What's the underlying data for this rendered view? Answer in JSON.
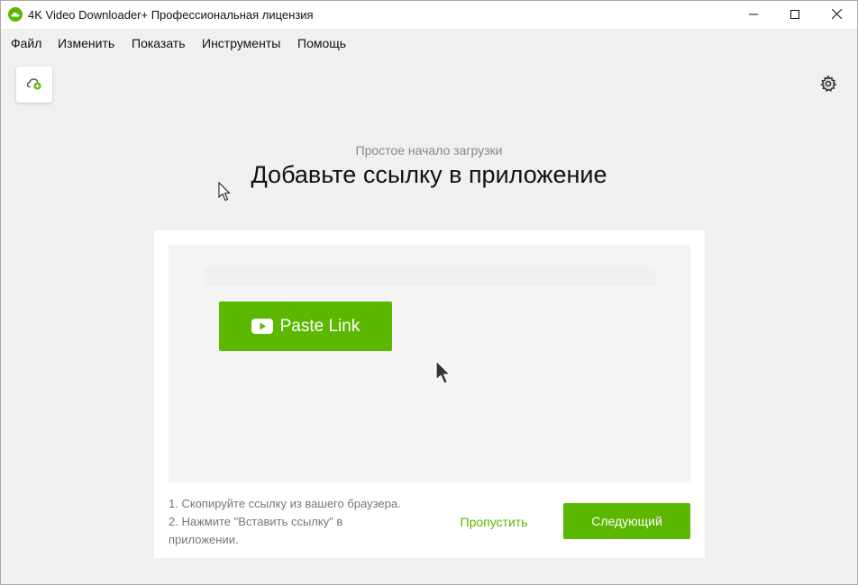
{
  "window": {
    "title": "4K Video Downloader+ Профессиональная лицензия",
    "app_icon": "cloud-download-icon",
    "controls": [
      "minimize-icon",
      "maximize-icon",
      "close-icon"
    ]
  },
  "menu": {
    "items": [
      {
        "label": "Файл"
      },
      {
        "label": "Изменить"
      },
      {
        "label": "Показать"
      },
      {
        "label": "Инструменты"
      },
      {
        "label": "Помощь"
      }
    ]
  },
  "toolbar": {
    "add_link_icon": "add-link-icon",
    "settings_icon": "gear-icon"
  },
  "onboarding": {
    "subtitle": "Простое начало загрузки",
    "headline": "Добавьте ссылку в приложение",
    "paste_button_label": "Paste Link",
    "paste_button_icon": "youtube-icon",
    "instruction_1": "1. Скопируйте ссылку из вашего браузера.",
    "instruction_2": "2. Нажмите \"Вставить ссылку\" в приложении.",
    "skip_label": "Пропустить",
    "next_label": "Следующий"
  },
  "colors": {
    "accent": "#5cb700",
    "background": "#f0f0f0",
    "card": "#ffffff",
    "preview": "#f4f4f4"
  }
}
